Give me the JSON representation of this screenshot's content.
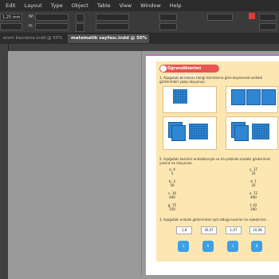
{
  "menu": [
    "Edit",
    "Layout",
    "Type",
    "Object",
    "Table",
    "View",
    "Window",
    "Help"
  ],
  "control": {
    "field_value": "1,25 mm"
  },
  "tabs": [
    {
      "label": "anım kavrama.indd @ 50%"
    },
    {
      "label": "matematik sayfası.indd @ 50%"
    }
  ],
  "document": {
    "section_title": "Öğrendiklerimi Uyguluyorum",
    "q1": "1. Aşağıdaki birimlerin hangi kısımlarına göre boyanarak ondalık gösterimleri yazıp okuyunuz.",
    "q2": "2. Aşağıdaki kesirleri ondalıklarıyla ve da şeklinde ondalık gösterimini yazınız ve okuyunuz.",
    "q3": "3. Aşağıdaki ondalık gösterimleri eşit olduğu kesirler ile eşleştiriniz.",
    "fractions": [
      {
        "n": "a",
        "num": "4",
        "den": "5"
      },
      {
        "n": "ç",
        "num": "17",
        "den": "25"
      },
      {
        "n": "b",
        "num": "3",
        "den": "50"
      },
      {
        "n": "d",
        "num": "1",
        "den": "25"
      },
      {
        "n": "c",
        "num": "19",
        "den": "400"
      },
      {
        "n": "e",
        "num": "72",
        "den": "400"
      },
      {
        "n": "ğ",
        "num": "75",
        "den": "150"
      },
      {
        "n": "f",
        "num": "42",
        "den": "200"
      }
    ],
    "answers": [
      "1,8",
      "30,07",
      "1,07",
      "10,08"
    ],
    "icon_labels": [
      "3",
      "6",
      "1",
      "8"
    ]
  }
}
